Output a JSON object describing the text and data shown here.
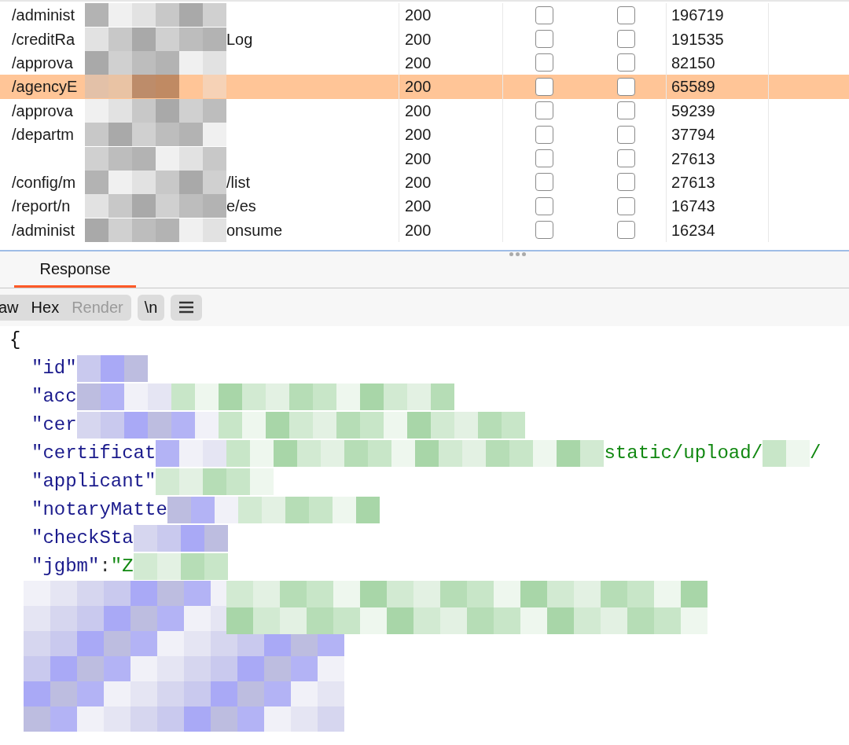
{
  "table": {
    "rows": [
      {
        "path_start": "/administ",
        "status": "200",
        "check_1": false,
        "check_2": false,
        "length": "196719",
        "selected": false
      },
      {
        "path_start": "/creditRa",
        "path_end": "Log",
        "status": "200",
        "check_1": false,
        "check_2": false,
        "length": "191535",
        "selected": false
      },
      {
        "path_start": "/approva",
        "status": "200",
        "check_1": false,
        "check_2": false,
        "length": "82150",
        "selected": false
      },
      {
        "path_start": "/agencyE",
        "status": "200",
        "check_1": false,
        "check_2": false,
        "length": "65589",
        "selected": true
      },
      {
        "path_start": "/approva",
        "status": "200",
        "check_1": false,
        "check_2": false,
        "length": "59239",
        "selected": false
      },
      {
        "path_start": "/departm",
        "status": "200",
        "check_1": false,
        "check_2": false,
        "length": "37794",
        "selected": false
      },
      {
        "status": "200",
        "check_1": false,
        "check_2": false,
        "length": "27613",
        "selected": false
      },
      {
        "path_start": "/config/m",
        "path_end": "/list",
        "status": "200",
        "check_1": false,
        "check_2": false,
        "length": "27613",
        "selected": false
      },
      {
        "path_start": "/report/n",
        "path_end": "e/es",
        "status": "200",
        "check_1": false,
        "check_2": false,
        "length": "16743",
        "selected": false
      },
      {
        "path_start": "/administ",
        "path_end": "onsume",
        "status": "200",
        "check_1": false,
        "check_2": false,
        "length": "16234",
        "selected": false
      }
    ]
  },
  "response_panel": {
    "tabs": [
      {
        "label": "Response",
        "selected": true
      }
    ],
    "view_modes": [
      {
        "label": "aw",
        "disabled": false
      },
      {
        "label": "Hex",
        "disabled": false
      },
      {
        "label": "Render",
        "disabled": true
      }
    ],
    "tools": [
      {
        "kind": "text",
        "label": "\\n"
      },
      {
        "kind": "menu"
      }
    ],
    "code_lines": [
      {
        "kind": "brace",
        "text": "{"
      },
      {
        "kind": "entry",
        "key": "\"id\""
      },
      {
        "kind": "entry",
        "key": "\"acc"
      },
      {
        "kind": "entry",
        "key": "\"cer"
      },
      {
        "kind": "entry",
        "key": "\"certificat",
        "value": "static/upload/",
        "value_end": "/"
      },
      {
        "kind": "entry",
        "key": "\"applicant\""
      },
      {
        "kind": "entry",
        "key": "\"notaryMatte"
      },
      {
        "kind": "entry",
        "key": "\"checkSta"
      },
      {
        "kind": "entry",
        "key": "\"jgbm\"",
        "colon": ":",
        "value": "\"Z"
      }
    ]
  }
}
